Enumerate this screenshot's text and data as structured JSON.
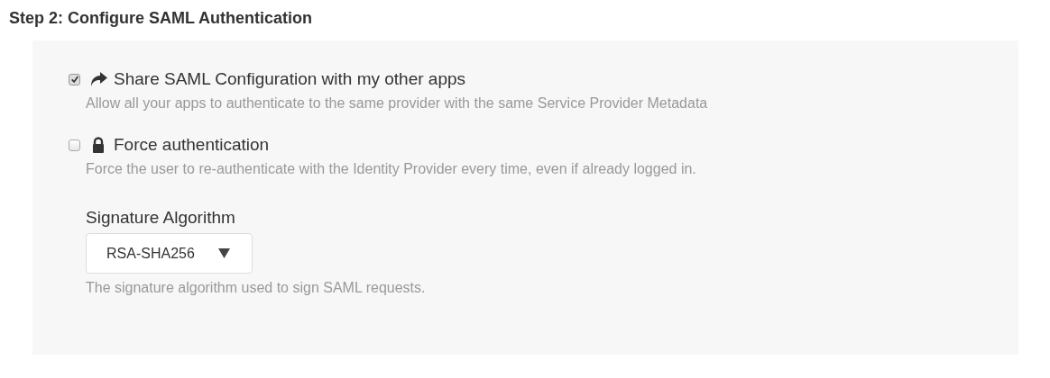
{
  "heading": "Step 2: Configure SAML Authentication",
  "options": [
    {
      "kind": "share",
      "label": "Share SAML Configuration with my other apps",
      "description": "Allow all your apps to authenticate to the same provider with the same Service Provider Metadata",
      "checked": true
    },
    {
      "kind": "lock",
      "label": "Force authentication",
      "description": "Force the user to re-authenticate with the Identity Provider every time, even if already logged in.",
      "checked": false
    }
  ],
  "signature": {
    "label": "Signature Algorithm",
    "value": "RSA-SHA256",
    "help": "The signature algorithm used to sign SAML requests."
  }
}
